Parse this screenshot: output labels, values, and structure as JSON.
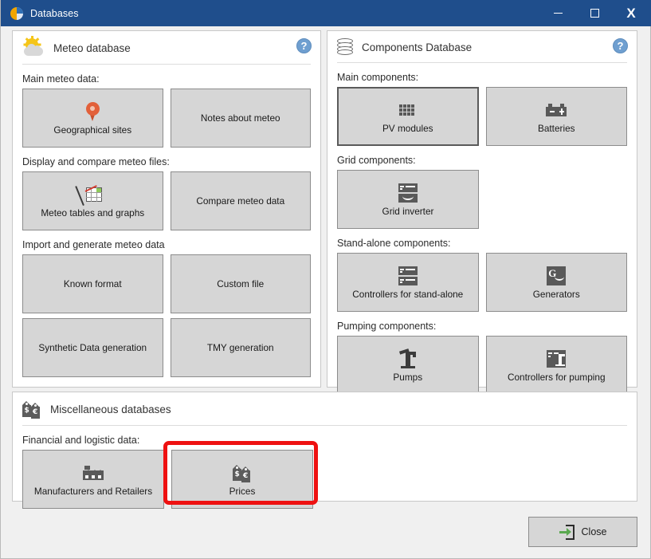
{
  "window": {
    "title": "Databases",
    "icon": "app-pie-icon",
    "controls": {
      "minimize": "–",
      "maximize": "□",
      "close": "X"
    }
  },
  "panels": {
    "meteo": {
      "title": "Meteo database",
      "icon": "sun-cloud-icon",
      "help": "?",
      "groups": [
        {
          "label": "Main meteo data:",
          "buttons": [
            {
              "label": "Geographical sites",
              "icon": "map-pin-icon",
              "focused": false
            },
            {
              "label": "Notes about meteo",
              "icon": "none",
              "focused": false
            }
          ]
        },
        {
          "label": "Display and compare meteo files:",
          "buttons": [
            {
              "label": "Meteo tables and graphs",
              "icon": "chart-table-icon",
              "focused": false
            },
            {
              "label": "Compare meteo data",
              "icon": "none",
              "focused": false
            }
          ]
        },
        {
          "label": "Import and generate meteo data",
          "buttons": [
            {
              "label": "Known format",
              "icon": "none",
              "focused": false
            },
            {
              "label": "Custom file",
              "icon": "none",
              "focused": false
            },
            {
              "label": "Synthetic Data generation",
              "icon": "none",
              "focused": false
            },
            {
              "label": "TMY generation",
              "icon": "none",
              "focused": false
            }
          ]
        }
      ]
    },
    "components": {
      "title": "Components Database",
      "icon": "database-cylinder-icon",
      "help": "?",
      "groups": [
        {
          "label": "Main components:",
          "buttons": [
            {
              "label": "PV modules",
              "icon": "pv-module-icon",
              "focused": true
            },
            {
              "label": "Batteries",
              "icon": "battery-icon",
              "focused": false
            }
          ]
        },
        {
          "label": "Grid components:",
          "buttons": [
            {
              "label": "Grid inverter",
              "icon": "grid-inverter-icon",
              "focused": false
            }
          ]
        },
        {
          "label": "Stand-alone components:",
          "buttons": [
            {
              "label": "Controllers for stand-alone",
              "icon": "controller-icon",
              "focused": false
            },
            {
              "label": "Generators",
              "icon": "generator-icon",
              "focused": false
            }
          ]
        },
        {
          "label": "Pumping components:",
          "buttons": [
            {
              "label": "Pumps",
              "icon": "pump-icon",
              "focused": false
            },
            {
              "label": "Controllers for pumping",
              "icon": "pump-controller-icon",
              "focused": false
            }
          ]
        }
      ]
    },
    "misc": {
      "title": "Miscellaneous databases",
      "icon": "price-tags-icon",
      "groups": [
        {
          "label": "Financial and logistic data:",
          "buttons": [
            {
              "label": "Manufacturers and Retailers",
              "icon": "factory-icon",
              "focused": false
            },
            {
              "label": "Prices",
              "icon": "price-tags-icon",
              "focused": false,
              "highlighted": true
            }
          ]
        }
      ]
    }
  },
  "footer": {
    "close_label": "Close",
    "close_icon": "exit-arrow-icon"
  },
  "colors": {
    "titlebar": "#1f4e8c",
    "button_face": "#d6d6d6",
    "highlight": "#ee1111",
    "accent_green": "#5aa84f"
  }
}
